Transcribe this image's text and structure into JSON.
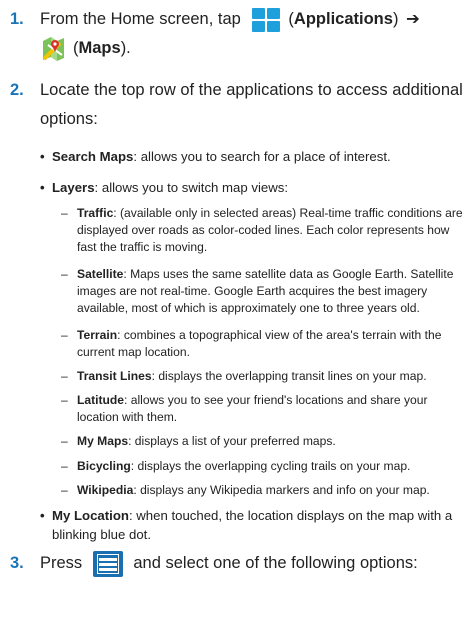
{
  "steps": [
    {
      "number": "1.",
      "line1_pre": "From the Home screen, tap",
      "apps_icon": "applications-grid-icon",
      "apps_label": "Applications",
      "arrow": "➔",
      "maps_icon": "maps-icon",
      "maps_label": "Maps"
    },
    {
      "number": "2.",
      "text": "Locate the top row of the applications to access additional options:"
    },
    {
      "number": "3.",
      "text_pre": "Press",
      "menu_icon": "menu-key-icon",
      "text_post": "and select one of the following options:"
    }
  ],
  "bullets": [
    {
      "term": "Search Maps",
      "desc": ": allows you to search for a place of interest."
    },
    {
      "term": "Layers",
      "desc": ": allows you to switch map views:"
    },
    {
      "term": "My Location",
      "desc": ": when touched, the location displays on the map with a blinking blue dot."
    }
  ],
  "layers": [
    {
      "term": "Traffic",
      "desc": ": (available only in selected areas) Real-time traffic conditions are displayed over roads as color-coded lines. Each color represents how fast the traffic is moving."
    },
    {
      "term": "Satellite",
      "desc": ": Maps uses the same satellite data as Google Earth. Satellite images are not real-time. Google Earth acquires the best imagery available, most of which is approximately one to three years old."
    },
    {
      "term": "Terrain",
      "desc": ": combines a topographical view of the area's terrain with the current map location."
    },
    {
      "term": "Transit Lines",
      "desc": ": displays the overlapping transit lines on your map."
    },
    {
      "term": "Latitude",
      "desc": ": allows you to see your friend's locations and share your location with them."
    },
    {
      "term": "My Maps",
      "desc": ": displays a list of your preferred maps."
    },
    {
      "term": "Bicycling",
      "desc": ": displays the overlapping cycling trails on your map."
    },
    {
      "term": "Wikipedia",
      "desc": ": displays any Wikipedia markers and info on your map."
    }
  ],
  "colors": {
    "step_number": "#1a75b8",
    "apps_icon": "#1ea0dc",
    "menu_icon": "#1a6fb0"
  }
}
